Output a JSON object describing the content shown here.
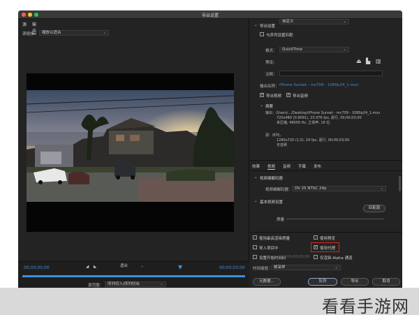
{
  "window": {
    "title": "导出设置"
  },
  "left": {
    "tabs": [
      "源",
      "输出"
    ],
    "source_scaling_label": "源缩放：",
    "source_scaling_value": "缩放以适合"
  },
  "timeline": {
    "timecode_in": "00;00;00;00",
    "timecode_out": "00;00;03;00",
    "fit_label": "适合",
    "source_range_label": "源范围：",
    "source_range_value": "序列切入/序列切出"
  },
  "right": {
    "export_settings_header": "导出设置",
    "match_sequence_label": "与序列设置匹配",
    "format_label": "格式：",
    "format_value": "QuickTime",
    "preset_label": "预设：",
    "preset_value": "自定义",
    "comments_label": "注释：",
    "output_name_label": "输出名称：",
    "output_name_value": "iPhone Sunset - mc709 - 1080p24_1.mov",
    "export_video_label": "导出视频",
    "export_audio_label": "导出音频",
    "summary_header": "摘要",
    "summary_output": "输出：/Users/.../Desktop/iPhone Sunset - mc709 - 1080p24_1.mov",
    "summary_line2": "720x480 (0.9091), 23.976 fps, 逐行, 00;00;03;00",
    "summary_line3": "未压缩, 48000 Hz, 立体声, 16 位",
    "summary_source_label": "源：序列，",
    "summary_source_line": "1280x720 (1.0), 24 fps, 逐行, 00;00;03;00",
    "summary_source_line3": "无音频",
    "tabs": [
      "效果",
      "视频",
      "音频",
      "字幕",
      "发布"
    ],
    "video_codec_header": "视频编解码器",
    "video_codec_label": "视频编解码器：",
    "video_codec_value": "DV 25 NTSC 24p",
    "basic_video_header": "基本视频设置",
    "match_source_button": "匹配源",
    "quality_label": "质量",
    "use_max_render_quality": "使用最高渲染质量",
    "use_previews": "使用预览",
    "import_into_project": "导入项目中",
    "use_proxies": "使用代理",
    "set_start_timecode": "设置开始时间码",
    "set_start_timecode_value": "00;00;00;00",
    "render_alpha_only": "仅渲染 Alpha 通道",
    "time_interpolation_label": "时间插值：",
    "time_interpolation_value": "帧采样",
    "metadata_button": "元数据...",
    "queue_button": "队列",
    "export_button": "导出",
    "cancel_button": "取消"
  },
  "watermark": {
    "text": "看看手游网"
  }
}
